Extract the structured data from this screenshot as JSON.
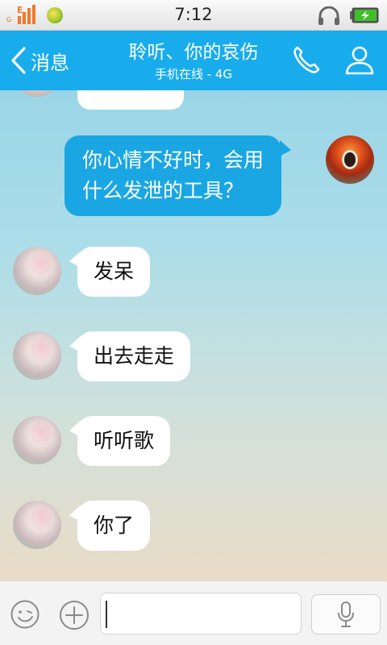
{
  "status_bar": {
    "time": "7:12",
    "icons": [
      "signal-icon",
      "coin-app-icon",
      "headset-icon",
      "battery-charging-icon"
    ]
  },
  "header": {
    "back_label": "消息",
    "title": "聆听、你的哀伤",
    "subtitle": "手机在线 - 4G",
    "accent_color": "#19acec",
    "icons": [
      "chevron-left-icon",
      "phone-icon",
      "user-profile-icon"
    ]
  },
  "chat": {
    "messages": [
      {
        "from": "me",
        "text_lines": [
          "你心情不好时，会用",
          "什么发泄的工具？"
        ]
      },
      {
        "from": "friend",
        "text": "发呆"
      },
      {
        "from": "friend",
        "text": "出去走走"
      },
      {
        "from": "friend",
        "text": "听听歌"
      },
      {
        "from": "friend",
        "text": "你了"
      }
    ]
  },
  "input_bar": {
    "value": "",
    "icons": [
      "emoji-icon",
      "plus-icon",
      "microphone-icon"
    ]
  }
}
